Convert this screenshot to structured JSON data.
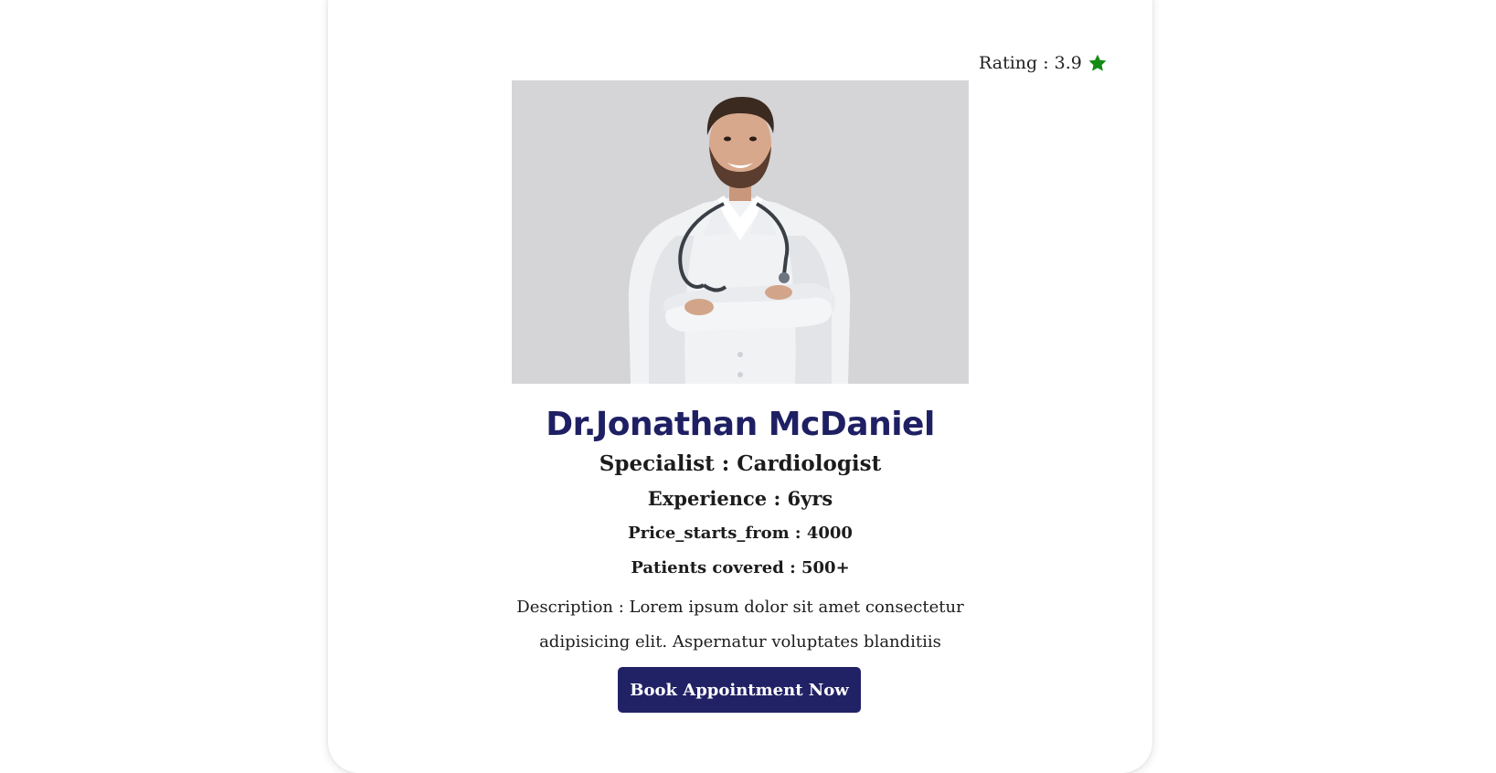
{
  "rating": {
    "label": "Rating : 3.9",
    "icon": "star-icon",
    "icon_color": "#138a13"
  },
  "doctor": {
    "photo_bg_color": "#d5d5d7",
    "name": "Dr.Jonathan McDaniel",
    "specialist": "Specialist : Cardiologist",
    "experience": "Experience : 6yrs",
    "price": "Price_starts_from : 4000",
    "patients": "Patients covered : 500+",
    "description": "Description : Lorem ipsum dolor sit amet consectetur adipisicing elit. Aspernatur voluptates blanditiis"
  },
  "actions": {
    "book_label": "Book Appointment Now"
  },
  "colors": {
    "accent": "#212266",
    "name_color": "#1f2063"
  }
}
